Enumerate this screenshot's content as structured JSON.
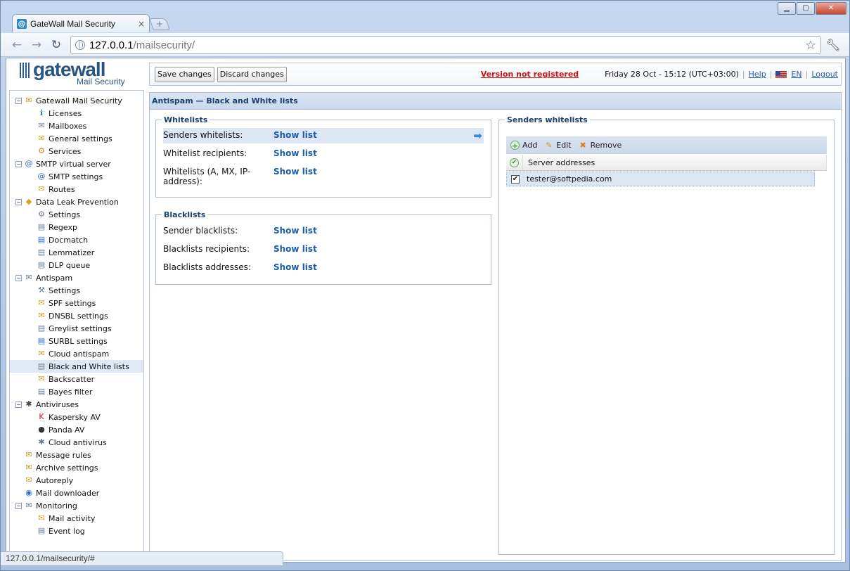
{
  "browser": {
    "tab_title": "GateWall Mail Security",
    "tab_close": "×",
    "new_tab": "+",
    "url_host": "127.0.0.1",
    "url_path": "/mailsecurity/",
    "status_url": "127.0.0.1/mailsecurity/#",
    "window_buttons": [
      "▁",
      "▢",
      "✕"
    ]
  },
  "logo": {
    "brand": "gatewall",
    "subtitle": "Mail Security"
  },
  "topbar": {
    "save": "Save changes",
    "discard": "Discard changes",
    "version": "Version not registered",
    "datetime": "Friday 28 Oct - 15:12 (UTC+03:00)",
    "help": "Help",
    "lang": "EN",
    "logout": "Logout"
  },
  "sidebar": {
    "items": [
      {
        "label": "Gatewall Mail Security",
        "level": 0,
        "icon": "gatewall-icon",
        "glyph": "✉",
        "color": "#d49a1c"
      },
      {
        "label": "Licenses",
        "level": 1,
        "icon": "info-icon",
        "glyph": "ℹ",
        "color": "#2a6fc9"
      },
      {
        "label": "Mailboxes",
        "level": 1,
        "icon": "mailbox-icon",
        "glyph": "✉",
        "color": "#6b7d93"
      },
      {
        "label": "General settings",
        "level": 1,
        "icon": "settings-icon",
        "glyph": "✉",
        "color": "#d49a1c"
      },
      {
        "label": "Services",
        "level": 1,
        "icon": "services-icon",
        "glyph": "⚙",
        "color": "#c8861c"
      },
      {
        "label": "SMTP virtual server",
        "level": 0,
        "icon": "smtp-icon",
        "glyph": "@",
        "color": "#2a6fc9"
      },
      {
        "label": "SMTP settings",
        "level": 1,
        "icon": "smtp-settings-icon",
        "glyph": "@",
        "color": "#2a6fc9"
      },
      {
        "label": "Routes",
        "level": 1,
        "icon": "routes-icon",
        "glyph": "✉",
        "color": "#d49a1c"
      },
      {
        "label": "Data Leak Prevention",
        "level": 0,
        "icon": "dlp-icon",
        "glyph": "◆",
        "color": "#d4a41c"
      },
      {
        "label": "Settings",
        "level": 1,
        "icon": "dlp-settings-icon",
        "glyph": "⚙",
        "color": "#6b7d93"
      },
      {
        "label": "Regexp",
        "level": 1,
        "icon": "regexp-icon",
        "glyph": "▤",
        "color": "#6b7d93"
      },
      {
        "label": "Docmatch",
        "level": 1,
        "icon": "docmatch-icon",
        "glyph": "▤",
        "color": "#2a6fc9"
      },
      {
        "label": "Lemmatizer",
        "level": 1,
        "icon": "lemmatizer-icon",
        "glyph": "▤",
        "color": "#6b7d93"
      },
      {
        "label": "DLP queue",
        "level": 1,
        "icon": "dlp-queue-icon",
        "glyph": "▤",
        "color": "#6b7d93"
      },
      {
        "label": "Antispam",
        "level": 0,
        "icon": "antispam-icon",
        "glyph": "✉",
        "color": "#6b7d93"
      },
      {
        "label": "Settings",
        "level": 1,
        "icon": "antispam-settings-icon",
        "glyph": "⚒",
        "color": "#6b7d93"
      },
      {
        "label": "SPF settings",
        "level": 1,
        "icon": "spf-icon",
        "glyph": "✉",
        "color": "#d49a1c"
      },
      {
        "label": "DNSBL settings",
        "level": 1,
        "icon": "dnsbl-icon",
        "glyph": "✉",
        "color": "#d49a1c"
      },
      {
        "label": "Greylist settings",
        "level": 1,
        "icon": "greylist-icon",
        "glyph": "▤",
        "color": "#6b7d93"
      },
      {
        "label": "SURBL settings",
        "level": 1,
        "icon": "surbl-icon",
        "glyph": "▤",
        "color": "#2a6fc9"
      },
      {
        "label": "Cloud antispam",
        "level": 1,
        "icon": "cloud-antispam-icon",
        "glyph": "✉",
        "color": "#d49a1c"
      },
      {
        "label": "Black and White lists",
        "level": 1,
        "icon": "lists-icon",
        "glyph": "▤",
        "color": "#6b7d93",
        "selected": true
      },
      {
        "label": "Backscatter",
        "level": 1,
        "icon": "backscatter-icon",
        "glyph": "✉",
        "color": "#d49a1c"
      },
      {
        "label": "Bayes filter",
        "level": 1,
        "icon": "bayes-icon",
        "glyph": "▤",
        "color": "#6b7d93"
      },
      {
        "label": "Antiviruses",
        "level": 0,
        "icon": "antivirus-icon",
        "glyph": "✱",
        "color": "#444"
      },
      {
        "label": "Kaspersky AV",
        "level": 1,
        "icon": "kaspersky-icon",
        "glyph": "K",
        "color": "#c0161c"
      },
      {
        "label": "Panda AV",
        "level": 1,
        "icon": "panda-icon",
        "glyph": "●",
        "color": "#333"
      },
      {
        "label": "Cloud antivirus",
        "level": 1,
        "icon": "cloud-antivirus-icon",
        "glyph": "✱",
        "color": "#6b7d93"
      },
      {
        "label": "Message rules",
        "level": 0,
        "icon": "message-rules-icon",
        "glyph": "✉",
        "color": "#d49a1c"
      },
      {
        "label": "Archive settings",
        "level": 0,
        "icon": "archive-icon",
        "glyph": "✉",
        "color": "#d49a1c"
      },
      {
        "label": "Autoreply",
        "level": 0,
        "icon": "autoreply-icon",
        "glyph": "✉",
        "color": "#d49a1c"
      },
      {
        "label": "Mail downloader",
        "level": 0,
        "icon": "downloader-icon",
        "glyph": "◉",
        "color": "#2a6fc9"
      },
      {
        "label": "Monitoring",
        "level": 0,
        "icon": "monitoring-icon",
        "glyph": "✉",
        "color": "#6b7d93"
      },
      {
        "label": "Mail activity",
        "level": 1,
        "icon": "mail-activity-icon",
        "glyph": "✉",
        "color": "#d49a1c"
      },
      {
        "label": "Event log",
        "level": 1,
        "icon": "event-log-icon",
        "glyph": "▤",
        "color": "#6b7d93"
      }
    ]
  },
  "content": {
    "header": "Antispam — Black and White lists",
    "whitelists": {
      "title": "Whitelists",
      "rows": [
        {
          "label": "Senders whitelists:",
          "link": "Show list"
        },
        {
          "label": "Whitelist recipients:",
          "link": "Show list"
        },
        {
          "label": "Whitelists (A, MX, IP-address):",
          "link": "Show list"
        }
      ]
    },
    "blacklists": {
      "title": "Blacklists",
      "rows": [
        {
          "label": "Sender blacklists:",
          "link": "Show list"
        },
        {
          "label": "Blacklists recipients:",
          "link": "Show list"
        },
        {
          "label": "Blacklists addresses:",
          "link": "Show list"
        }
      ]
    },
    "senders_panel": {
      "title": "Senders whitelists",
      "add": "Add",
      "edit": "Edit",
      "remove": "Remove",
      "column": "Server addresses",
      "rows": [
        {
          "address": "tester@softpedia.com",
          "checked": true
        }
      ]
    }
  }
}
